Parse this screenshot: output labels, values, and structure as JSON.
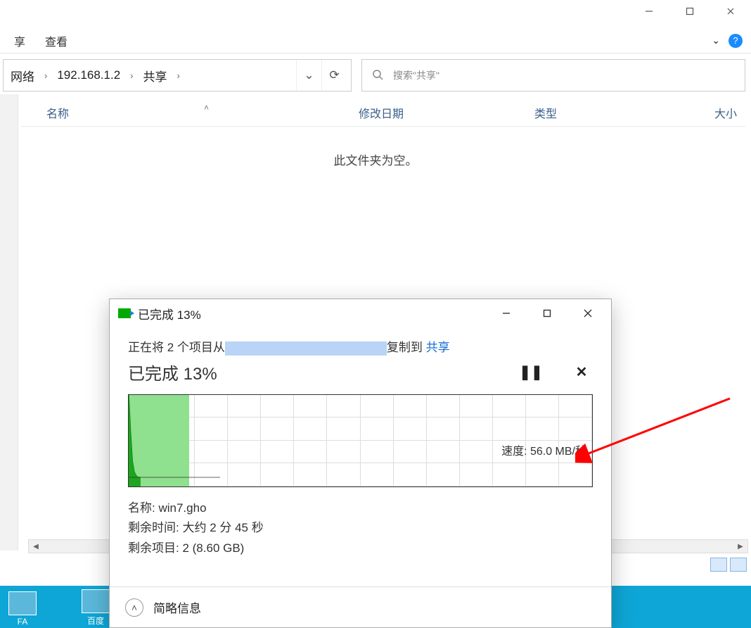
{
  "window": {
    "min_tip": "—",
    "max_tip": "▢",
    "close_tip": "✕"
  },
  "menu": {
    "item1": "享",
    "item2": "查看",
    "chevron": "⌄"
  },
  "address": {
    "seg1": "网络",
    "seg2": "192.168.1.2",
    "seg3": "共享",
    "refresh": "⟳",
    "drop": "⌄"
  },
  "search": {
    "placeholder": "搜索\"共享\""
  },
  "columns": {
    "name": "名称",
    "modified": "修改日期",
    "type": "类型",
    "size": "大小"
  },
  "empty_text": "此文件夹为空。",
  "taskbar": {
    "icon1": "FA",
    "icon2": "百度"
  },
  "dialog": {
    "title": "已完成 13%",
    "subtitle_prefix": "正在将 2 个项目从",
    "subtitle_mid": "复制到",
    "subtitle_dest": "共享",
    "progress_label": "已完成 13%",
    "speed_label": "速度: 56.0 MB/秒",
    "stat_name_label": "名称:",
    "stat_name_value": "win7.gho",
    "stat_time_label": "剩余时间:",
    "stat_time_value": "大约 2 分 45 秒",
    "stat_items_label": "剩余项目:",
    "stat_items_value": "2 (8.60 GB)",
    "footer": "简略信息"
  },
  "chart_data": {
    "type": "area",
    "xlabel": "",
    "ylabel": "",
    "x": [
      0,
      2,
      4,
      6,
      8,
      10,
      12,
      13
    ],
    "values": [
      100,
      60,
      28,
      16,
      12,
      10,
      10,
      10
    ],
    "ylim": [
      0,
      100
    ],
    "progress_pct": 13,
    "speed_label": "速度: 56.0 MB/秒"
  }
}
